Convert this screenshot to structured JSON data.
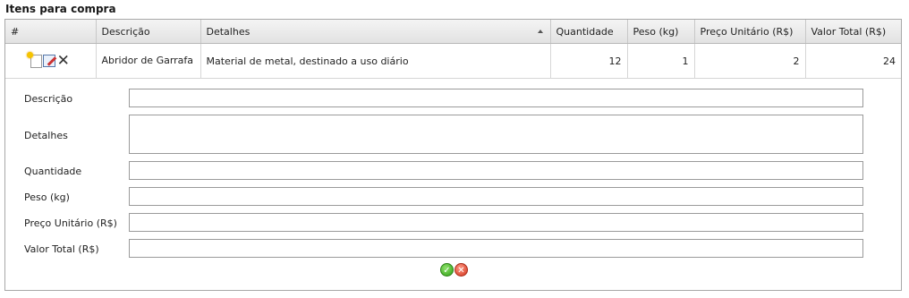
{
  "section": {
    "title": "Itens para compra"
  },
  "grid": {
    "columns": [
      "#",
      "Descrição",
      "Detalhes",
      "Quantidade",
      "Peso (kg)",
      "Preço Unitário (R$)",
      "Valor Total (R$)"
    ],
    "sorted_column": "Detalhes",
    "rows": [
      {
        "actions": [
          "new-icon",
          "edit-icon",
          "delete-icon"
        ],
        "descricao": "Abridor de Garrafa",
        "detalhes": "Material de metal, destinado a uso diário",
        "quantidade": "12",
        "peso": "1",
        "preco_unitario": "2",
        "valor_total": "24"
      }
    ]
  },
  "form": {
    "descricao_label": "Descrição",
    "detalhes_label": "Detalhes",
    "quantidade_label": "Quantidade",
    "peso_label": "Peso (kg)",
    "preco_label": "Preço Unitário (R$)",
    "valor_label": "Valor Total (R$)",
    "descricao_value": "",
    "detalhes_value": "",
    "quantidade_value": "",
    "peso_value": "",
    "preco_value": "",
    "valor_value": ""
  },
  "buttons": {
    "confirm_icon": "check-icon",
    "cancel_icon": "cancel-icon"
  },
  "colors": {
    "header_bg": "#e8e8e8",
    "border": "#a8a8a8",
    "ok_green": "#3aa81c",
    "cancel_red": "#d83a22"
  }
}
